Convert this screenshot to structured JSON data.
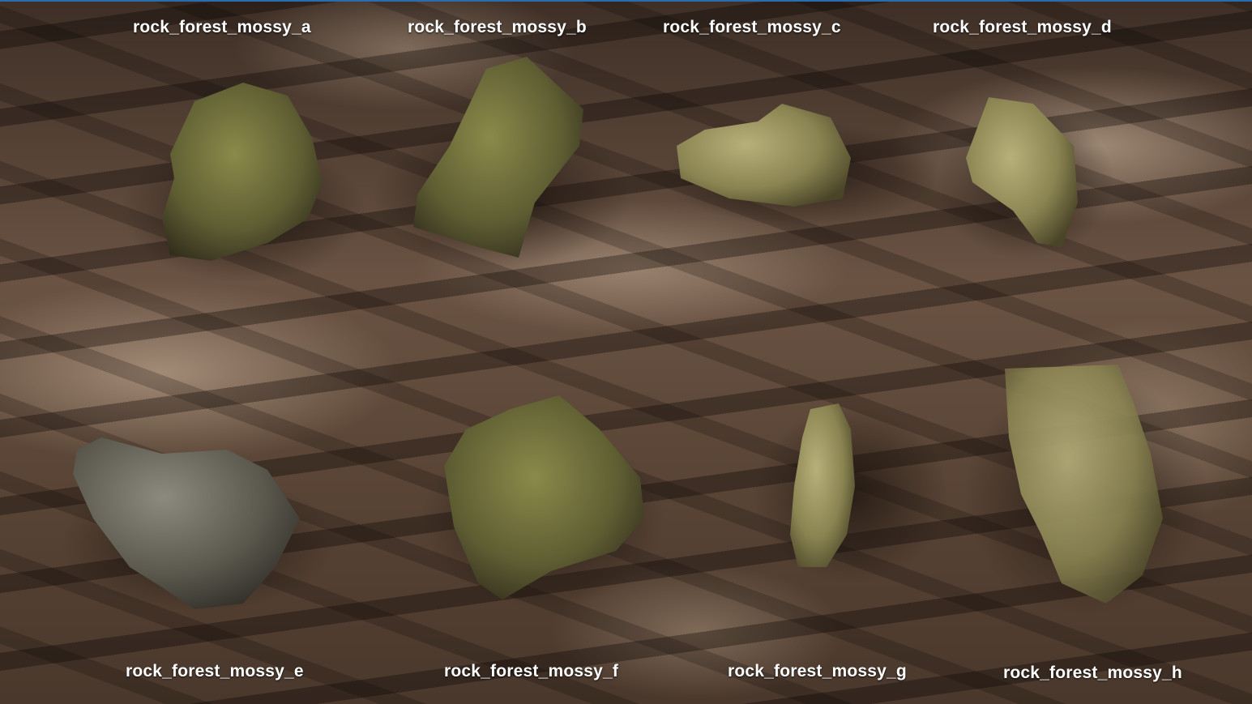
{
  "labels": {
    "a": "rock_forest_mossy_a",
    "b": "rock_forest_mossy_b",
    "c": "rock_forest_mossy_c",
    "d": "rock_forest_mossy_d",
    "e": "rock_forest_mossy_e",
    "f": "rock_forest_mossy_f",
    "g": "rock_forest_mossy_g",
    "h": "rock_forest_mossy_h"
  },
  "colors": {
    "ground": "#5a4638",
    "rock_moss": "#6a6a3a",
    "rock_grey": "#5f5d52",
    "shadow": "#2b1f18",
    "frame_accent": "#2a6cb0"
  }
}
